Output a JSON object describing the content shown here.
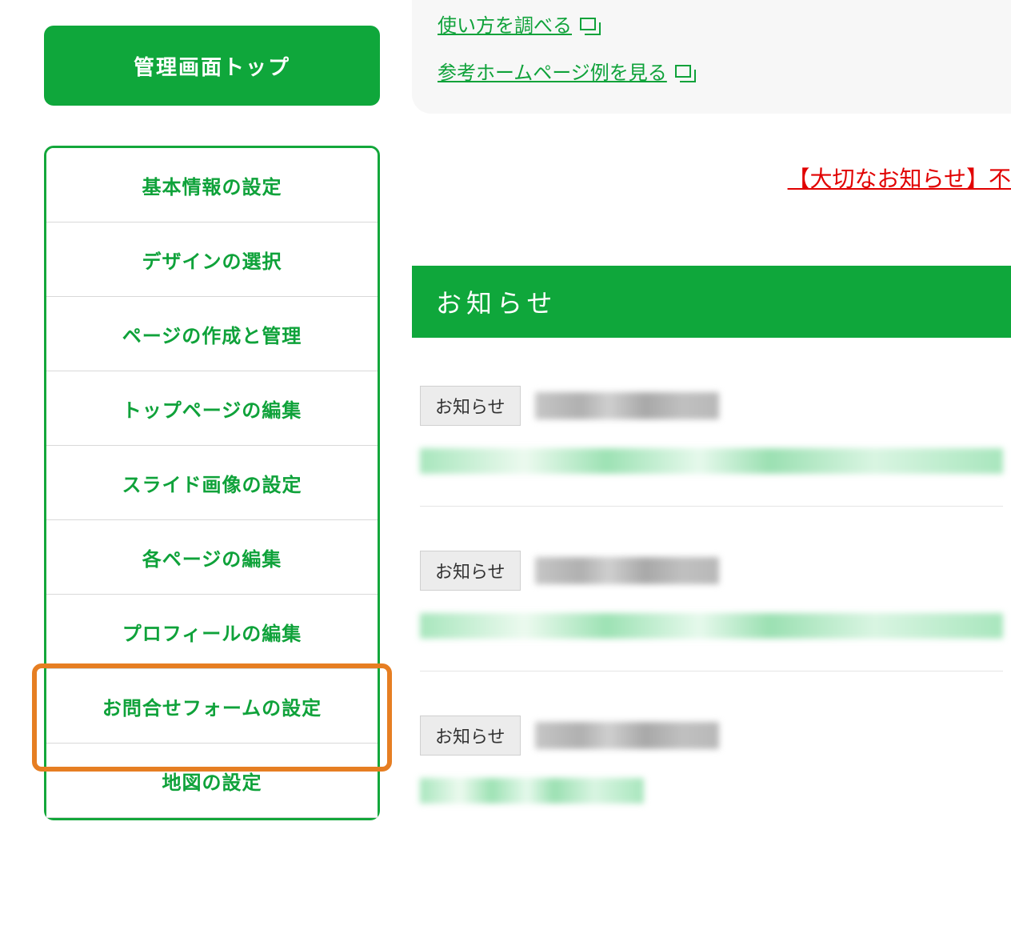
{
  "sidebar": {
    "top_button_label": "管理画面トップ",
    "items": [
      {
        "label": "基本情報の設定"
      },
      {
        "label": "デザインの選択"
      },
      {
        "label": "ページの作成と管理"
      },
      {
        "label": "トップページの編集"
      },
      {
        "label": "スライド画像の設定"
      },
      {
        "label": "各ページの編集"
      },
      {
        "label": "プロフィールの編集"
      },
      {
        "label": "お問合せフォームの設定"
      },
      {
        "label": "地図の設定"
      }
    ]
  },
  "help": {
    "link1": "使い方を調べる",
    "link2": "参考ホームページ例を見る"
  },
  "important_notice": "【大切なお知らせ】不",
  "section": {
    "news_header": "お知らせ"
  },
  "news": {
    "badge_label": "お知らせ",
    "items": [
      {
        "badge": "お知らせ"
      },
      {
        "badge": "お知らせ"
      },
      {
        "badge": "お知らせ"
      }
    ]
  }
}
